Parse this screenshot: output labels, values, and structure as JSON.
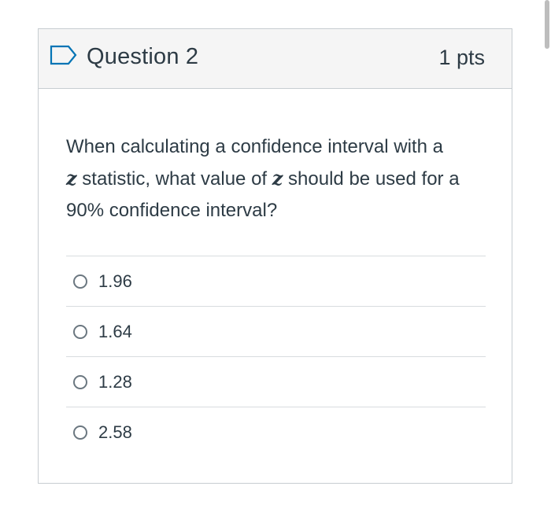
{
  "question": {
    "title": "Question 2",
    "points": "1 pts",
    "text_part1": "When calculating a confidence interval with a",
    "variable": "z",
    "text_part2": " statistic, what value of ",
    "text_part3": " should be used for a 90% confidence interval?",
    "flag_icon": "flag-outline-icon"
  },
  "answers": [
    {
      "label": "1.96",
      "selected": false
    },
    {
      "label": "1.64",
      "selected": false
    },
    {
      "label": "1.28",
      "selected": false
    },
    {
      "label": "2.58",
      "selected": false
    }
  ],
  "colors": {
    "text": "#2d3b45",
    "header_bg": "#f5f5f5",
    "border": "#c7cdd1",
    "flag": "#0374b5"
  }
}
